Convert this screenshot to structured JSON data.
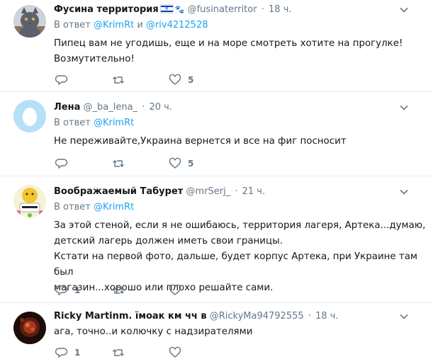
{
  "tweets": [
    {
      "name": "Фусина территория",
      "handle": "@fusinaterritor",
      "time": "18 ч.",
      "reply_prefix": "В ответ",
      "reply_to": "@KrimRt",
      "reply_joiner": " и ",
      "reply_to2": "@riv4212528",
      "text": "Пипец вам не угодишь, еще и на море смотреть хотите на прогулке!\nВозмутительно!",
      "reply_count": "",
      "retweet_count": "",
      "like_count": "5",
      "avatar": "cat-avatar"
    },
    {
      "name": "Лена",
      "handle": "@_ba_lena_",
      "time": "20 ч.",
      "reply_prefix": "В ответ",
      "reply_to": "@KrimRt",
      "text": "Не переживайте,Украина вернется и все на фиг посносит",
      "reply_count": "",
      "retweet_count": "",
      "like_count": "5",
      "avatar": "default-egg-avatar"
    },
    {
      "name": "Воображаемый Табурет",
      "handle": "@mrSerj_",
      "time": "21 ч.",
      "reply_prefix": "В ответ",
      "reply_to": "@KrimRt",
      "text": "За этой стеной, если я не ошибаюсь, территория лагеря, Артека...думаю,\nдетский лагерь должен иметь свои границы.\nКстати на первой фото, дальше, будет корпус Артека, при Украине там был\nмагазин...хорошо или плохо решайте сами.",
      "reply_count": "1",
      "retweet_count": "",
      "like_count": "",
      "avatar": "cartoon-avatar"
    },
    {
      "name": "Ricky Martinm. їмоак км чч в",
      "handle": "@RickyMa94792555",
      "time": "18 ч.",
      "text": "ага, точно..и колючку с надзирателями",
      "reply_count": "1",
      "retweet_count": "",
      "like_count": "",
      "avatar": "dark-avatar"
    }
  ],
  "colors": {
    "accent": "#1da1f2",
    "muted": "#657786",
    "border": "#e6ecf0"
  }
}
